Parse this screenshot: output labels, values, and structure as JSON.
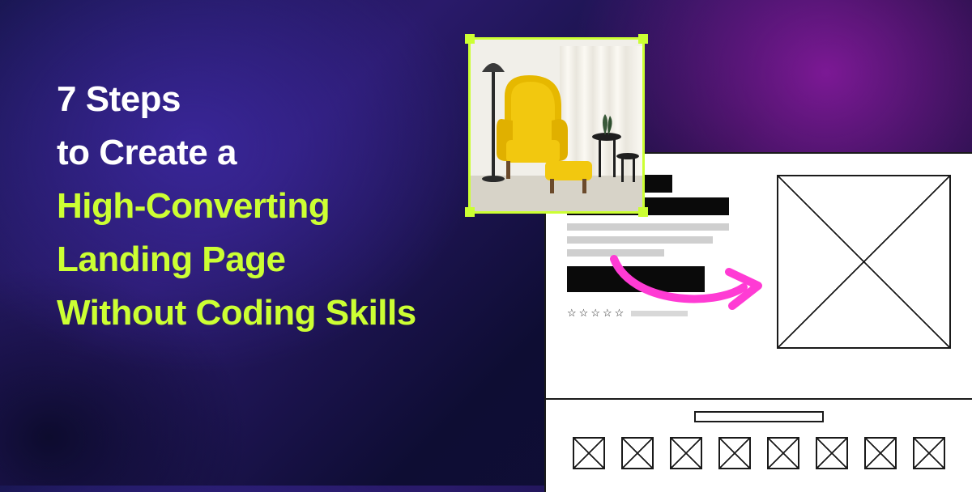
{
  "headline": {
    "line1": "7 Steps",
    "line2": "to Create a",
    "line3": "High-Converting",
    "line4": "Landing Page",
    "line5": "Without Coding Skills"
  },
  "colors": {
    "accent": "#ccff33",
    "arrow": "#ff3bd4",
    "text_light": "#ffffff",
    "wireframe_stroke": "#1a1a1a"
  },
  "drag_image": {
    "name": "armchair-photo",
    "subject": "yellow armchair with ottoman and floor lamp",
    "selected": true,
    "handles": 4
  },
  "wireframe": {
    "stars_count": 5,
    "thumbnails_count": 8
  }
}
